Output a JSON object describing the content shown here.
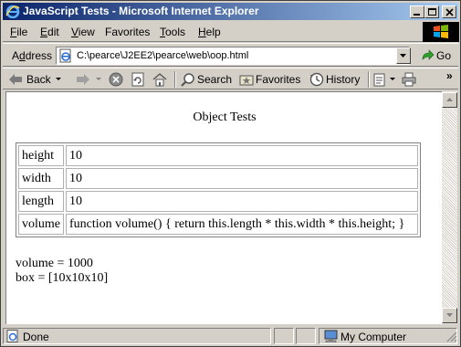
{
  "window": {
    "title": "JavaScript Tests - Microsoft Internet Explorer"
  },
  "menu": {
    "items": [
      {
        "key": "F",
        "rest": "ile"
      },
      {
        "key": "E",
        "rest": "dit"
      },
      {
        "key": "V",
        "rest": "iew"
      },
      {
        "key": "F",
        "rest": "avorites",
        "prefix": ""
      },
      {
        "key": "T",
        "rest": "ools"
      },
      {
        "key": "H",
        "rest": "elp"
      }
    ]
  },
  "address": {
    "label_key": "d",
    "label_pre": "A",
    "label_post": "dress",
    "url": "C:\\pearce\\J2EE2\\pearce\\web\\oop.html",
    "go_label": "Go"
  },
  "toolbar": {
    "back_label": "Back",
    "search_label": "Search",
    "favorites_label": "Favorites",
    "history_label": "History"
  },
  "page": {
    "heading": "Object Tests",
    "properties": [
      {
        "name": "height",
        "value": "10"
      },
      {
        "name": "width",
        "value": "10"
      },
      {
        "name": "length",
        "value": "10"
      },
      {
        "name": "volume",
        "value": "function volume() { return this.length * this.width * this.height; }"
      }
    ],
    "output": [
      "volume = 1000",
      "box = [10x10x10]"
    ]
  },
  "status": {
    "text": "Done",
    "zone": "My Computer"
  },
  "colors": {
    "title_gradient_start": "#0a246a",
    "title_gradient_end": "#a6caf0",
    "chrome": "#d4d0c8"
  }
}
